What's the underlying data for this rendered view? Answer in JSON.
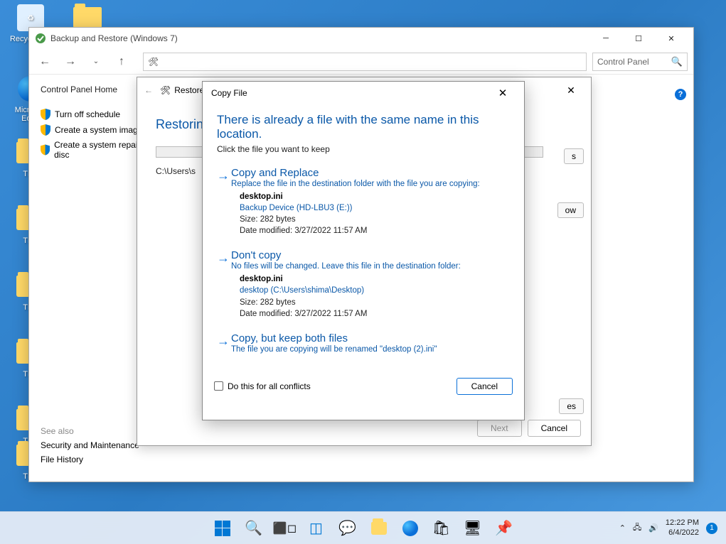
{
  "desktop": {
    "recycle": "Recycle Bin",
    "edge": "Microsoft Edge",
    "folders": [
      "TES",
      "TES",
      "TES",
      "TES",
      "TES"
    ]
  },
  "window": {
    "title": "Backup and Restore (Windows 7)"
  },
  "addressbar": {
    "text": ""
  },
  "searchbox": {
    "placeholder": "Control Panel"
  },
  "sidebar": {
    "home": "Control Panel Home",
    "links": [
      "Turn off schedule",
      "Create a system image",
      "Create a system repair disc"
    ],
    "see_also": "See also",
    "see_links": [
      "Security and Maintenance",
      "File History"
    ]
  },
  "wizard": {
    "heading_text": "Restore",
    "title": "Restoring",
    "path": "C:\\Users\\s",
    "btn_s": "s",
    "btn_ow": "ow",
    "btn_es": "es",
    "next": "Next",
    "cancel": "Cancel"
  },
  "dialog": {
    "title": "Copy File",
    "heading": "There is already a file with the same name in this location.",
    "sub": "Click the file you want to keep",
    "opt1": {
      "title": "Copy and Replace",
      "desc": "Replace the file in the destination folder with the file you are copying:",
      "name": "desktop.ini",
      "loc": "Backup Device (HD-LBU3 (E:))",
      "size": "Size: 282 bytes",
      "date": "Date modified: 3/27/2022 11:57 AM"
    },
    "opt2": {
      "title": "Don't copy",
      "desc": "No files will be changed. Leave this file in the destination folder:",
      "name": "desktop.ini",
      "loc": "desktop (C:\\Users\\shima\\Desktop)",
      "size": "Size: 282 bytes",
      "date": "Date modified: 3/27/2022 11:57 AM"
    },
    "opt3": {
      "title": "Copy, but keep both files",
      "desc": "The file you are copying will be renamed \"desktop (2).ini\""
    },
    "checkbox": "Do this for all conflicts",
    "cancel": "Cancel"
  },
  "taskbar": {
    "time": "12:22 PM",
    "date": "6/4/2022",
    "badge": "1"
  }
}
